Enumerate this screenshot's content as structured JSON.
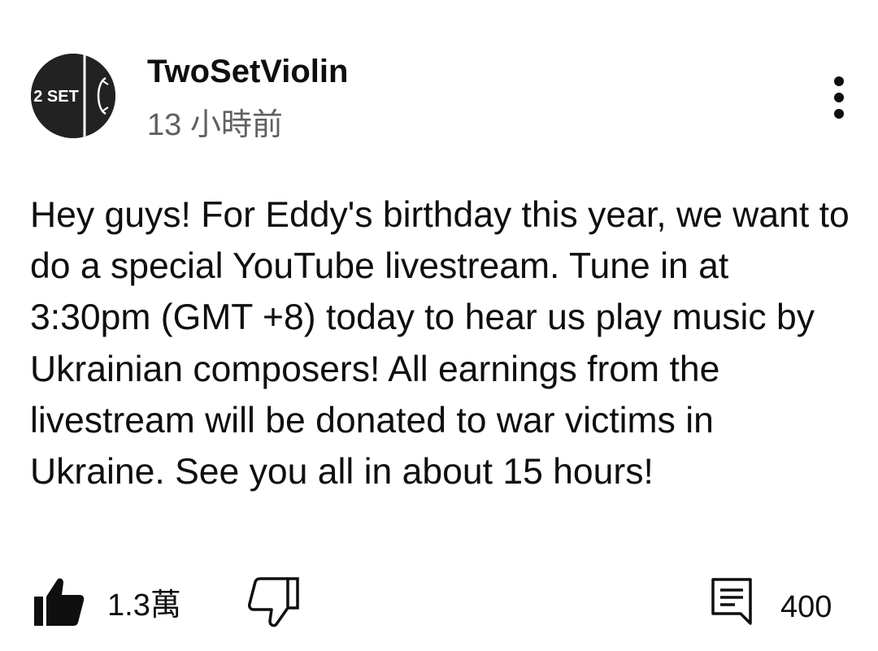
{
  "post": {
    "channel_name": "TwoSetViolin",
    "avatar_text": "2 SET",
    "timestamp": "13 小時前",
    "body": "Hey guys! For Eddy's birthday this year, we want to do a special YouTube livestream. Tune in at 3:30pm (GMT +8) today to hear us play music by Ukrainian composers! All earnings from the livestream will be donated to war victims in Ukraine. See you all in about 15 hours!"
  },
  "actions": {
    "like_count": "1.3萬",
    "comment_count": "400"
  },
  "icons": {
    "more": "more-vert-icon",
    "like": "thumbs-up-filled-icon",
    "dislike": "thumbs-down-outline-icon",
    "comment": "comment-icon"
  },
  "colors": {
    "text_primary": "#0f0f0f",
    "text_secondary": "#606060",
    "avatar_background": "#222222"
  }
}
